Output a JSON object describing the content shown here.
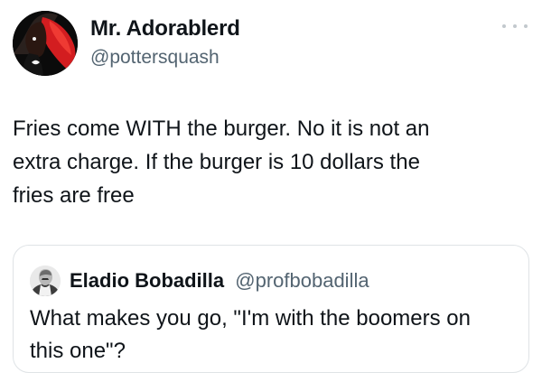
{
  "tweet": {
    "author": {
      "name": "Mr. Adorablerd",
      "handle": "@pottersquash",
      "avatar": "profile-photo"
    },
    "text": "Fries come WITH the burger. No it is not an\nextra charge. If the burger is 10 dollars the\nfries are free",
    "more_icon": "more-options-icon"
  },
  "quoted_tweet": {
    "author": {
      "name": "Eladio Bobadilla",
      "handle": "@profbobadilla",
      "avatar": "profile-photo"
    },
    "text": "What makes you go, \"I'm with the boomers on\nthis one\"?"
  },
  "colors": {
    "text": "#0f1419",
    "secondary_text": "#536471",
    "quote_border": "#dfe3e6"
  }
}
